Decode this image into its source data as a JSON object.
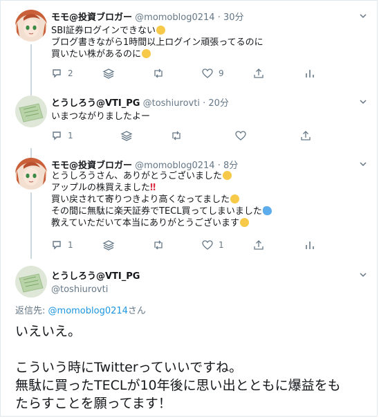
{
  "tweets": [
    {
      "name": "モモ@投資ブロガー",
      "handle": "@momoblog0214",
      "time": "· 30分",
      "lines": [
        "SBI証券ログインできない",
        "ブログ書きながら1時間以上ログイン頑張ってるのに",
        "買いたい株があるのに"
      ],
      "counts": {
        "reply": "2",
        "retweet": "",
        "like": "9"
      }
    },
    {
      "name": "とうしろう@VTI_PG",
      "handle": "@toshiurovti",
      "time": "· 20分",
      "lines": [
        "いまつながりましたよー"
      ],
      "counts": {
        "reply": "1",
        "retweet": "",
        "like": ""
      }
    },
    {
      "name": "モモ@投資ブロガー",
      "handle": "@momoblog0214",
      "time": "· 8分",
      "lines": [
        "とうしろうさん、ありがとうございました",
        "アップルの株買えました",
        "買い戻されて寄りつきより高くなってました",
        "その間に無駄に楽天証券でTECL買ってしまいました",
        "教えていただいて本当にありがとうございます"
      ],
      "counts": {
        "reply": "1",
        "retweet": "",
        "like": "1"
      }
    }
  ],
  "main_tweet": {
    "name": "とうしろう@VTI_PG",
    "handle": "@toshiurovti",
    "reply_prefix": "返信先:",
    "reply_handle": "@momoblog0214",
    "reply_suffix": "さん",
    "lines": [
      "いえいえ。",
      "",
      "こういう時にTwitterっていいですね。",
      "無駄に買ったTECLが10年後に思い出とともに爆益をも",
      "たらすことを願ってます！"
    ]
  },
  "icons": [
    "reply-icon",
    "stack-icon",
    "retweet-icon",
    "like-icon",
    "share-icon",
    "analytics-icon",
    "chevron-down-icon"
  ],
  "colors": {
    "link": "#1b95e0",
    "muted": "#657786",
    "thread": "#ccd6dd",
    "text": "#14171a"
  }
}
